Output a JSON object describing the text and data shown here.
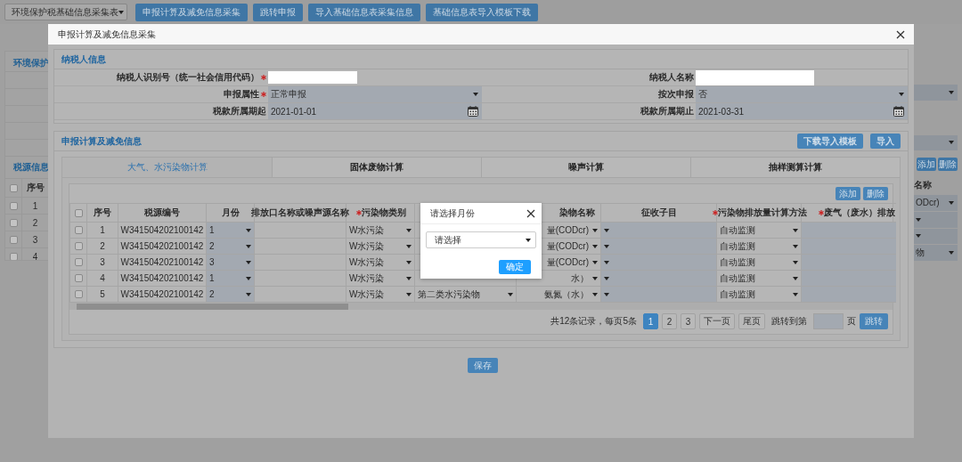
{
  "background": {
    "selector": "环境保护税基础信息采集表",
    "toolbar_buttons": [
      "申报计算及减免信息采集",
      "跳转申报",
      "导入基础信息表采集信息",
      "基础信息表导入模板下载"
    ],
    "left_panel": {
      "title": "环境保护",
      "section": "税源信息",
      "header": "序号",
      "header_checked": false,
      "rows": [
        {
          "no": "1",
          "checked": false
        },
        {
          "no": "2",
          "checked": false
        },
        {
          "no": "3",
          "checked": false
        },
        {
          "no": "4",
          "checked": false
        }
      ]
    },
    "right_panel": {
      "buttons": [
        "添加",
        "删除"
      ],
      "header": "名称",
      "cells": [
        "ODcr)",
        "",
        "",
        "物"
      ]
    }
  },
  "dialog": {
    "title": "申报计算及减免信息采集",
    "taxpayer": {
      "title": "纳税人信息",
      "fields": [
        {
          "label": "纳税人识别号（统一社会信用代码）",
          "required": true,
          "kind": "redacted"
        },
        {
          "label": "纳税人名称",
          "required": false,
          "kind": "redacted"
        },
        {
          "label": "申报属性",
          "required": true,
          "kind": "select",
          "value": "正常申报"
        },
        {
          "label": "按次申报",
          "required": false,
          "kind": "select",
          "value": "否"
        },
        {
          "label": "税款所属期起",
          "required": false,
          "kind": "date",
          "value": "2021-01-01"
        },
        {
          "label": "税款所属期止",
          "required": false,
          "kind": "date",
          "value": "2021-03-31"
        }
      ]
    },
    "calculation": {
      "title": "申报计算及减免信息",
      "buttons": [
        "下载导入模板",
        "导入"
      ],
      "tabs": [
        {
          "label": "大气、水污染物计算",
          "selected": true
        },
        {
          "label": "固体废物计算",
          "selected": false
        },
        {
          "label": "噪声计算",
          "selected": false
        },
        {
          "label": "抽样测算计算",
          "selected": false
        }
      ],
      "table_buttons": [
        "添加",
        "删除"
      ],
      "header_checked": false,
      "columns": [
        {
          "label": "序号",
          "required": false,
          "kind": "text"
        },
        {
          "label": "税源编号",
          "required": false,
          "kind": "text"
        },
        {
          "label": "月份",
          "required": false,
          "kind": "picker"
        },
        {
          "label": "排放口名称或噪声源名称",
          "required": false,
          "kind": "text"
        },
        {
          "label": "污染物类别",
          "required": true,
          "kind": "select"
        },
        {
          "kind": "select"
        },
        {
          "label": "染物名称",
          "required": false,
          "kind": "select"
        },
        {
          "label": "征收子目",
          "required": false,
          "kind": "picker"
        },
        {
          "label": "污染物排放量计算方法",
          "required": true,
          "kind": "select"
        },
        {
          "label": "废气（废水）排放",
          "required": true,
          "kind": "input"
        }
      ],
      "rows": [
        {
          "checked": false,
          "no": "1",
          "source_id": "W341504202100142",
          "month": "1",
          "category": "W水污染",
          "name": "量(CODcr)",
          "method": "自动监测"
        },
        {
          "checked": false,
          "no": "2",
          "source_id": "W341504202100142",
          "month": "2",
          "category": "W水污染",
          "name": "量(CODcr)",
          "method": "自动监测"
        },
        {
          "checked": false,
          "no": "3",
          "source_id": "W341504202100142",
          "month": "3",
          "category": "W水污染",
          "name": "量(CODcr)",
          "method": "自动监测"
        },
        {
          "checked": false,
          "no": "4",
          "source_id": "W341504202100142",
          "month": "1",
          "category": "W水污染",
          "name": "水）",
          "method": "自动监测"
        },
        {
          "checked": false,
          "no": "5",
          "source_id": "W341504202100142",
          "month": "2",
          "category": "W水污染",
          "class": "第二类水污染物",
          "name": "氨氮（水）",
          "method": "自动监测"
        }
      ],
      "pagination": {
        "summary": "共12条记录，每页5条",
        "pages": [
          {
            "label": "1",
            "selected": true
          },
          {
            "label": "2",
            "selected": false
          },
          {
            "label": "3",
            "selected": false
          }
        ],
        "next": "下一页",
        "last": "尾页",
        "jump_label": "跳转到第",
        "jump_unit": "页",
        "jump_button": "跳转"
      }
    },
    "save": "保存",
    "month_picker": {
      "title": "请选择月份",
      "select": "请选择",
      "confirm": "确定"
    }
  }
}
